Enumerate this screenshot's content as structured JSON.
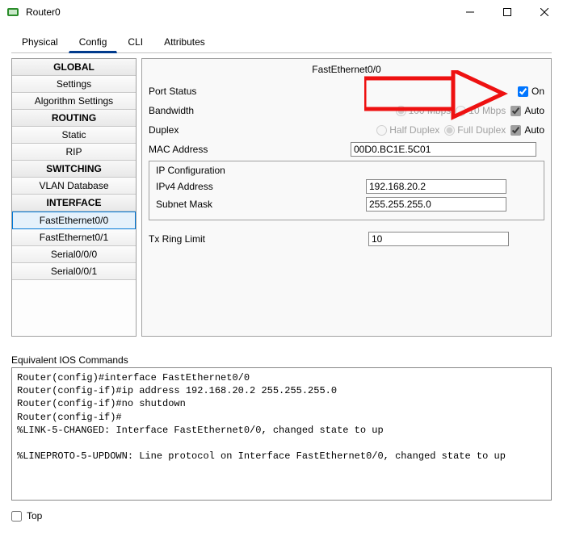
{
  "title": "Router0",
  "tabs": [
    "Physical",
    "Config",
    "CLI",
    "Attributes"
  ],
  "selected_tab": 1,
  "sidebar": {
    "sections": [
      {
        "header": "GLOBAL",
        "items": [
          "Settings",
          "Algorithm Settings"
        ]
      },
      {
        "header": "ROUTING",
        "items": [
          "Static",
          "RIP"
        ]
      },
      {
        "header": "SWITCHING",
        "items": [
          "VLAN Database"
        ]
      },
      {
        "header": "INTERFACE",
        "items": [
          "FastEthernet0/0",
          "FastEthernet0/1",
          "Serial0/0/0",
          "Serial0/0/1"
        ]
      }
    ],
    "selected": "FastEthernet0/0"
  },
  "config": {
    "title": "FastEthernet0/0",
    "port_status_label": "Port Status",
    "on_label": "On",
    "bandwidth_label": "Bandwidth",
    "bandwidth_opts": [
      "100 Mbps",
      "10 Mbps"
    ],
    "bandwidth_selected": 0,
    "duplex_label": "Duplex",
    "duplex_opts": [
      "Half Duplex",
      "Full Duplex"
    ],
    "duplex_selected": 1,
    "auto_label": "Auto",
    "mac_label": "MAC Address",
    "mac_value": "00D0.BC1E.5C01",
    "ipcfg_label": "IP Configuration",
    "ipv4_label": "IPv4 Address",
    "ipv4_value": "192.168.20.2",
    "subnet_label": "Subnet Mask",
    "subnet_value": "255.255.255.0",
    "txring_label": "Tx Ring Limit",
    "txring_value": "10"
  },
  "ios_label": "Equivalent IOS Commands",
  "ios_commands": "Router(config)#interface FastEthernet0/0\nRouter(config-if)#ip address 192.168.20.2 255.255.255.0\nRouter(config-if)#no shutdown\nRouter(config-if)#\n%LINK-5-CHANGED: Interface FastEthernet0/0, changed state to up\n\n%LINEPROTO-5-UPDOWN: Line protocol on Interface FastEthernet0/0, changed state to up\n",
  "top_label": "Top"
}
